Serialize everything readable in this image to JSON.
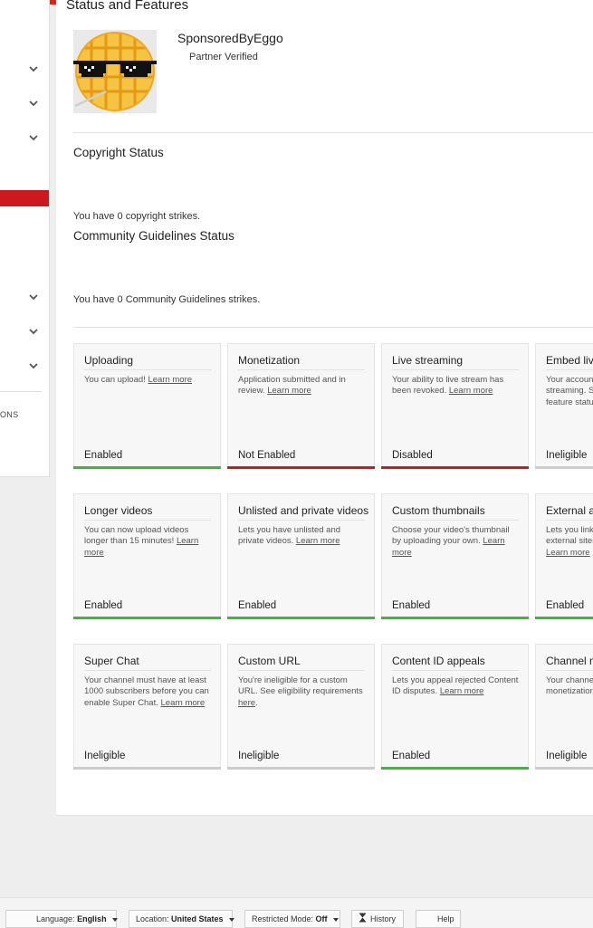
{
  "page": {
    "title": "Status and Features"
  },
  "channel": {
    "name": "SponsoredByEggo",
    "badge": "Partner Verified"
  },
  "sidebar": {
    "partial_label": "ONS"
  },
  "copyright": {
    "heading": "Copyright Status",
    "text": "You have 0 copyright strikes."
  },
  "community": {
    "heading": "Community Guidelines Status",
    "text": "You have 0 Community Guidelines strikes."
  },
  "colors": {
    "accent": "#e62117",
    "enabled": "#3cb836",
    "disabled": "#cc181e",
    "ineligible": "#cccccc"
  },
  "features": [
    {
      "title": "Uploading",
      "desc": "You can upload!",
      "link": "Learn more",
      "status": "Enabled",
      "state": "enabled"
    },
    {
      "title": "Monetization",
      "desc": "Application submitted and in review.",
      "link": "Learn more",
      "status": "Not Enabled",
      "state": "disabled"
    },
    {
      "title": "Live streaming",
      "desc": "Your ability to live stream has been revoked.",
      "link": "Learn more",
      "status": "Disabled",
      "state": "disabled"
    },
    {
      "title": "Embed live",
      "desc": "Your account streaming. S feature statu",
      "link": "",
      "status": "Ineligible",
      "state": "ineligible"
    },
    {
      "title": "Longer videos",
      "desc": "You can now upload videos longer than 15 minutes!",
      "link": "Learn more",
      "status": "Enabled",
      "state": "enabled"
    },
    {
      "title": "Unlisted and private videos",
      "desc": "Lets you have unlisted and private videos.",
      "link": "Learn more",
      "status": "Enabled",
      "state": "enabled"
    },
    {
      "title": "Custom thumbnails",
      "desc": "Choose your video's thumbnail by uploading your own.",
      "link": "Learn more",
      "status": "Enabled",
      "state": "enabled"
    },
    {
      "title": "External an",
      "desc": "Lets you link external sites",
      "link": "Learn more",
      "status": "Enabled",
      "state": "enabled"
    },
    {
      "title": "Super Chat",
      "desc": "Your channel must have at least 1000 subscribers before you can enable Super Chat.",
      "link": "Learn more",
      "status": "Ineligible",
      "state": "ineligible"
    },
    {
      "title": "Custom URL",
      "desc": "You're ineligible for a custom URL. See eligibility requirements",
      "link": "here",
      "status": "Ineligible",
      "state": "ineligible"
    },
    {
      "title": "Content ID appeals",
      "desc": "Lets you appeal rejected Content ID disputes.",
      "link": "Learn more",
      "status": "Enabled",
      "state": "enabled"
    },
    {
      "title": "Channel mo",
      "desc": "Your channel monetization",
      "link": "",
      "status": "Ineligible",
      "state": "ineligible"
    }
  ],
  "footer": {
    "language_label": "Language:",
    "language_value": "English",
    "location_label": "Location:",
    "location_value": "United States",
    "restricted_label": "Restricted Mode:",
    "restricted_value": "Off",
    "history": "History",
    "help": "Help"
  }
}
